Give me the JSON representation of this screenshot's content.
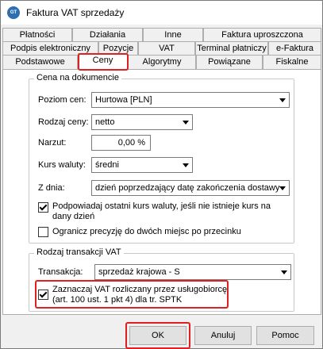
{
  "window": {
    "title": "Faktura VAT sprzedaży",
    "icon": "app-logo-icon"
  },
  "tabs": {
    "row1": [
      "Płatności",
      "Działania",
      "Inne",
      "Faktura uproszczona"
    ],
    "row2": [
      "Podpis elektroniczny",
      "Pozycje",
      "VAT",
      "Terminal płatniczy",
      "e-Faktura"
    ],
    "row3": [
      "Podstawowe",
      "Ceny",
      "Algorytmy",
      "Powiązane",
      "Fiskalne"
    ],
    "active": "Ceny"
  },
  "price_group": {
    "title": "Cena na dokumencie",
    "price_level": {
      "label": "Poziom cen:",
      "value": "Hurtowa [PLN]"
    },
    "price_type": {
      "label": "Rodzaj ceny:",
      "value": "netto"
    },
    "markup": {
      "label": "Narzut:",
      "value": "0,00 %"
    },
    "exchange_rate": {
      "label": "Kurs waluty:",
      "value": "średni"
    },
    "from_day": {
      "label": "Z dnia:",
      "value": "dzień poprzedzający datę zakończenia dostawy"
    },
    "suggest_last_rate": {
      "label": "Podpowiadaj ostatni kurs waluty, jeśli nie istnieje kurs na dany dzień",
      "checked": true
    },
    "limit_precision": {
      "label": "Ogranicz precyzję do dwóch miejsc po przecinku",
      "checked": false
    }
  },
  "vat_group": {
    "title": "Rodzaj transakcji VAT",
    "transaction": {
      "label": "Transakcja:",
      "value": "sprzedaż krajowa - S"
    },
    "mark_vat_service": {
      "label": "Zaznaczaj VAT rozliczany przez usługobiorcę (art. 100 ust. 1 pkt 4) dla tr. SPTK",
      "checked": true
    }
  },
  "buttons": {
    "ok": "OK",
    "cancel": "Anuluj",
    "help": "Pomoc"
  },
  "colors": {
    "highlight": "#e02020"
  }
}
